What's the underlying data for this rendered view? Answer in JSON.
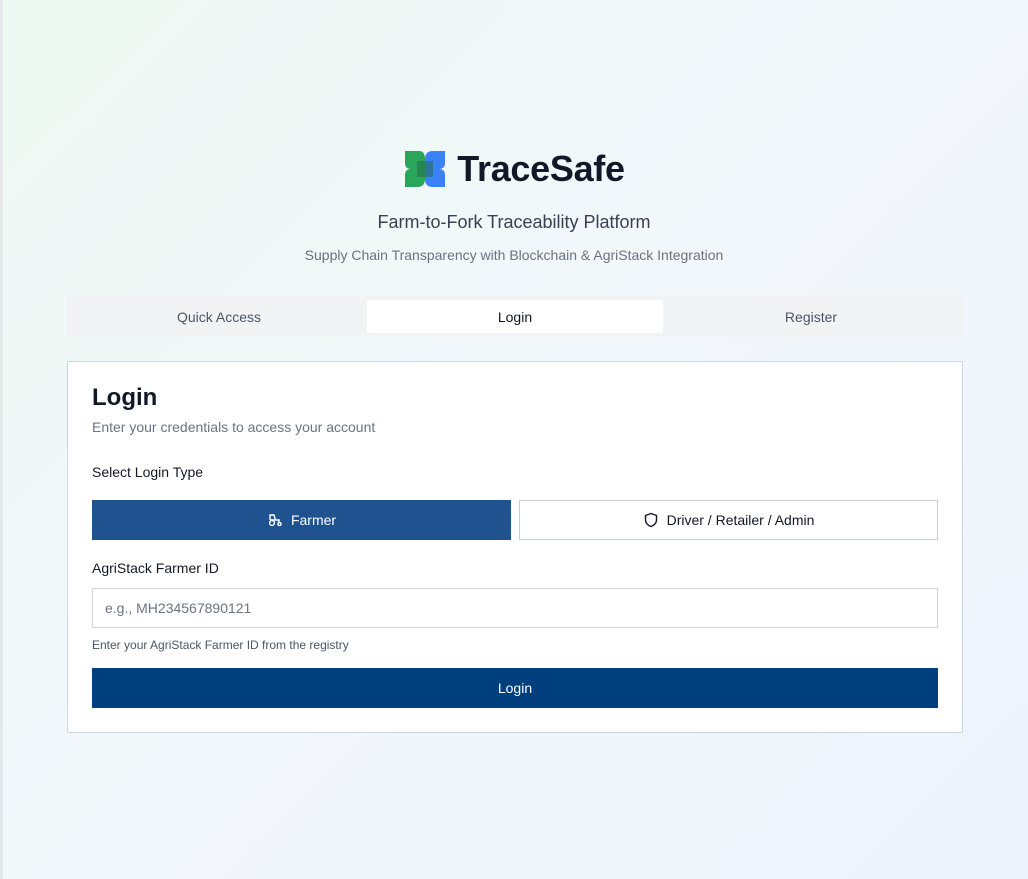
{
  "brand": {
    "title": "TraceSafe",
    "tagline": "Farm-to-Fork Traceability Platform",
    "subtagline": "Supply Chain Transparency with Blockchain & AgriStack Integration",
    "logo_colors": {
      "green": "#2aa65a",
      "blue": "#3b82f6",
      "overlap": "#1f6e4a"
    }
  },
  "tabs": [
    {
      "label": "Quick Access",
      "active": false
    },
    {
      "label": "Login",
      "active": true
    },
    {
      "label": "Register",
      "active": false
    }
  ],
  "card": {
    "title": "Login",
    "description": "Enter your credentials to access your account",
    "login_type_label": "Select Login Type",
    "login_types": [
      {
        "label": "Farmer",
        "icon": "tractor-icon",
        "selected": true
      },
      {
        "label": "Driver / Retailer / Admin",
        "icon": "shield-icon",
        "selected": false
      }
    ],
    "id_field": {
      "label": "AgriStack Farmer ID",
      "placeholder": "e.g., MH234567890121",
      "value": "",
      "hint": "Enter your AgriStack Farmer ID from the registry"
    },
    "submit_label": "Login"
  },
  "colors": {
    "primary": "#1f528e",
    "submit": "#003f7d"
  }
}
